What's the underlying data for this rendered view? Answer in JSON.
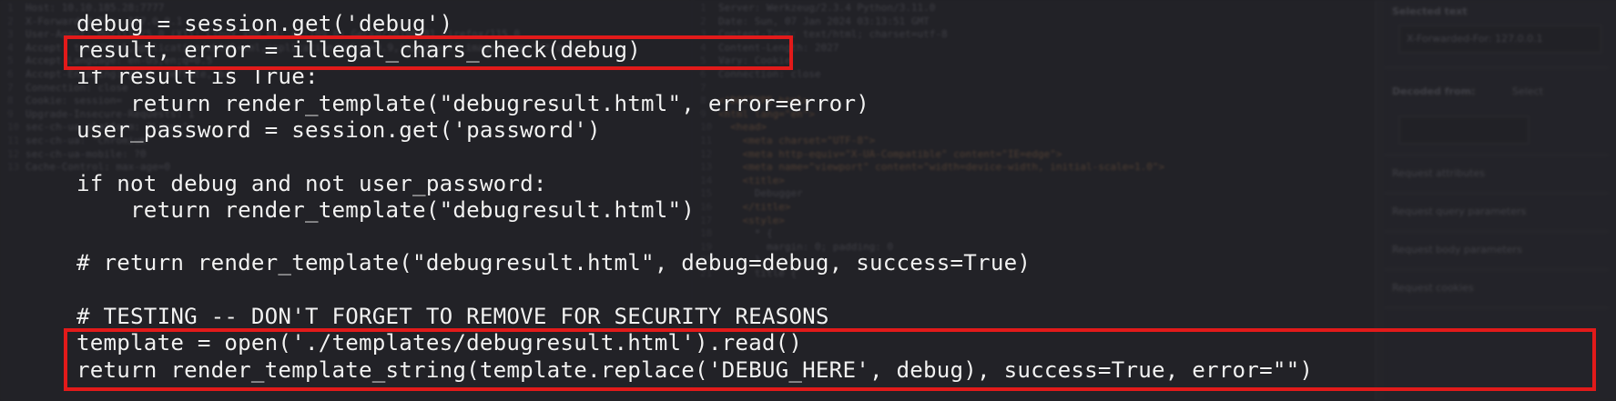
{
  "colors": {
    "highlight": "#e21a1a",
    "code_text": "#f2f2f2"
  },
  "code": {
    "lines": [
      "debug = session.get('debug')",
      "result, error = illegal_chars_check(debug)",
      "if result is True:",
      "    return render_template(\"debugresult.html\", error=error)",
      "user_password = session.get('password')",
      "",
      "if not debug and not user_password:",
      "    return render_template(\"debugresult.html\")",
      "",
      "# return render_template(\"debugresult.html\", debug=debug, success=True)",
      "",
      "# TESTING -- DON'T FORGET TO REMOVE FOR SECURITY REASONS",
      "template = open('./templates/debugresult.html').read()",
      "return render_template_string(template.replace('DEBUG_HERE', debug), success=True, error=\"\")"
    ]
  },
  "background": {
    "request_lines": [
      "Host: 10.10.185.28:7777",
      "X-Forwarded-For: 127.0.0.1",
      "User-Agent: Mozilla/5.0 (X11; Linux x86_64; rv:109.0) Gecko/20100101 Firefox/115.0",
      "Accept: text/html,application/xhtml+xml,application/xml;q=0.9,image/avif,image/webp,*/*;q=0.8",
      "Accept-Language: en-US,en;q=0.5",
      "Accept-Encoding: gzip, deflate, br",
      "Connection: close",
      "Cookie: session=",
      "Upgrade-Insecure-Requests: 1",
      "sec-ch-ua-platform: \"Linux\"",
      "sec-ch-ua: \"Chromium\"",
      "sec-ch-ua-mobile: ?0",
      "Cache-Control: max-age=0"
    ],
    "response_lines": [
      "Server: Werkzeug/2.3.4 Python/3.11.0",
      "Date: Sun, 07 Jan 2024 03:13:51 GMT",
      "Content-Type: text/html; charset=utf-8",
      "Content-Length: 2027",
      "Vary: Cookie",
      "Connection: close",
      "",
      "<!DOCTYPE html>",
      "<html lang=\"en\">",
      "  <head>",
      "    <meta charset=\"UTF-8\">",
      "    <meta http-equiv=\"X-UA-Compatible\" content=\"IE=edge\">",
      "    <meta name=\"viewport\" content=\"width=device-width, initial-scale=1.0\">",
      "    <title>",
      "      Debugger",
      "    </title>",
      "    <style>",
      "      * {",
      "        margin: 0; padding: 0",
      "      }",
      "      title {"
    ],
    "inspector": {
      "selected_text_label": "Selected text",
      "selected_text_value": "X-Forwarded-For: 127.0.0.1",
      "decoded_from_label": "Decoded from:",
      "decoded_from_value": "Select",
      "sections": [
        "Request attributes",
        "Request query parameters",
        "Request body parameters",
        "Request cookies"
      ]
    }
  }
}
